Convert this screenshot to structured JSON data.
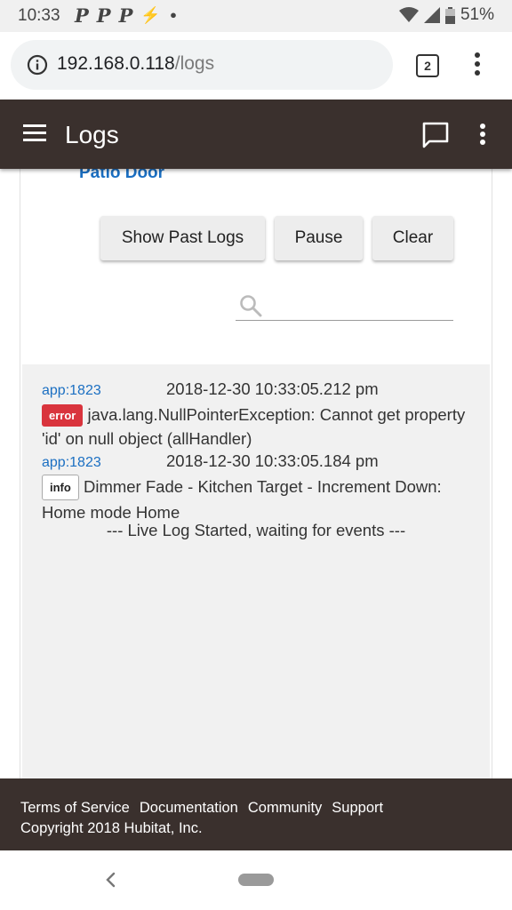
{
  "status": {
    "time": "10:33",
    "notifications": [
      "P",
      "P",
      "P",
      "⚡",
      "•"
    ],
    "battery": "51%"
  },
  "browser": {
    "url_host": "192.168.0.118",
    "url_path": "/logs",
    "tab_count": "2"
  },
  "header": {
    "title": "Logs"
  },
  "card": {
    "device_link": "Patio Door",
    "buttons": {
      "show_past": "Show Past Logs",
      "pause": "Pause",
      "clear": "Clear"
    },
    "search_placeholder": ""
  },
  "logs": [
    {
      "app": "app:1823",
      "time": "2018-12-30 10:33:05.212 pm",
      "level": "error",
      "message": "java.lang.NullPointerException: Cannot get property 'id' on null object (allHandler)"
    },
    {
      "app": "app:1823",
      "time": "2018-12-30 10:33:05.184 pm",
      "level": "info",
      "message": "Dimmer Fade - Kitchen Target - Increment Down: Home mode Home"
    }
  ],
  "live_message": "--- Live Log Started, waiting for events ---",
  "footer": {
    "links": [
      "Terms of Service",
      "Documentation",
      "Community",
      "Support"
    ],
    "copyright": "Copyright 2018 Hubitat, Inc."
  },
  "colors": {
    "header_bg": "#3a302d",
    "link": "#1b6fc2",
    "error_badge": "#d9343d"
  }
}
